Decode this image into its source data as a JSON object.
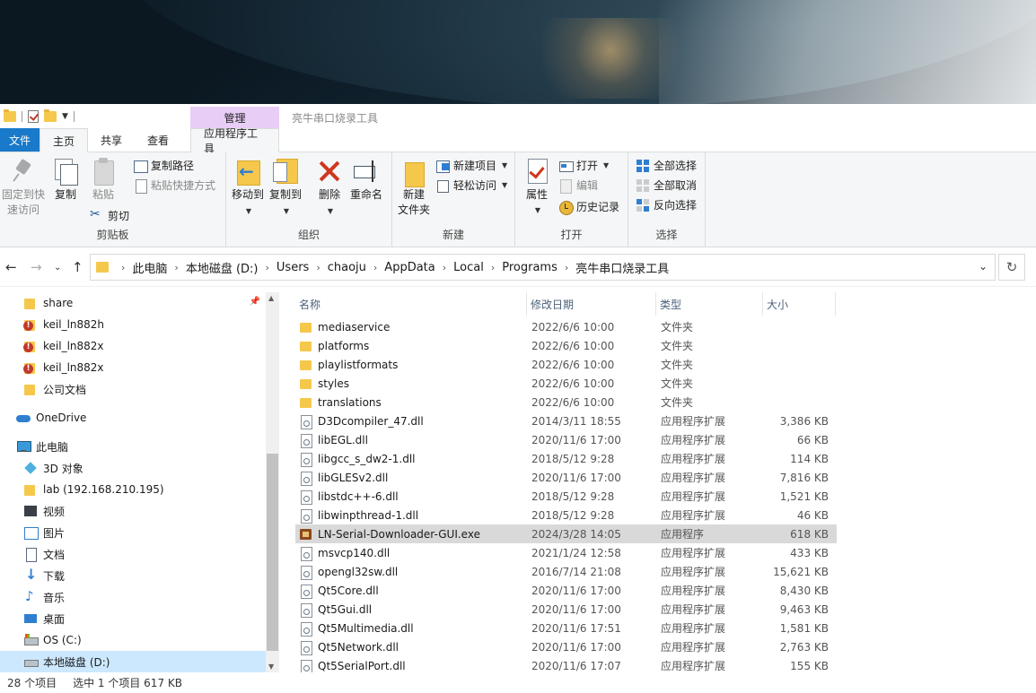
{
  "window_title": "亮牛串口烧录工具",
  "context_group": "管理",
  "tabs": [
    {
      "label": "文件"
    },
    {
      "label": "主页"
    },
    {
      "label": "共享"
    },
    {
      "label": "查看"
    },
    {
      "label": "应用程序工具"
    }
  ],
  "ribbon": {
    "clipboard": {
      "label": "剪贴板",
      "pin": "固定到快\n速访问",
      "pin_line1": "固定到快",
      "pin_line2": "速访问",
      "copy": "复制",
      "paste": "粘贴",
      "copy_path": "复制路径",
      "paste_shortcut": "粘贴快捷方式",
      "cut": "剪切"
    },
    "organize": {
      "label": "组织",
      "move_to": "移动到",
      "copy_to": "复制到",
      "delete": "删除",
      "rename": "重命名"
    },
    "new": {
      "label": "新建",
      "new_folder_line1": "新建",
      "new_folder_line2": "文件夹",
      "new_item": "新建项目",
      "easy_access": "轻松访问"
    },
    "open": {
      "label": "打开",
      "properties": "属性",
      "open": "打开",
      "edit": "编辑",
      "history": "历史记录"
    },
    "select": {
      "label": "选择",
      "select_all": "全部选择",
      "select_none": "全部取消",
      "invert": "反向选择"
    }
  },
  "address": {
    "crumbs": [
      "此电脑",
      "本地磁盘 (D:)",
      "Users",
      "chaoju",
      "AppData",
      "Local",
      "Programs",
      "亮牛串口烧录工具"
    ]
  },
  "nav": {
    "items": [
      {
        "label": "share",
        "icon": "folder-icon"
      },
      {
        "label": "keil_ln882h",
        "icon": "folder-error-icon"
      },
      {
        "label": "keil_ln882x",
        "icon": "folder-error-icon"
      },
      {
        "label": "keil_ln882x",
        "icon": "folder-error-icon"
      },
      {
        "label": "公司文档",
        "icon": "folder-icon"
      },
      {
        "label": "OneDrive",
        "icon": "onedrive-icon"
      },
      {
        "label": "此电脑",
        "icon": "pc-icon"
      },
      {
        "label": "3D 对象",
        "icon": "3d-objects-icon"
      },
      {
        "label": "lab (192.168.210.195)",
        "icon": "network-folder-icon"
      },
      {
        "label": "视频",
        "icon": "video-icon"
      },
      {
        "label": "图片",
        "icon": "pictures-icon"
      },
      {
        "label": "文档",
        "icon": "documents-icon"
      },
      {
        "label": "下载",
        "icon": "downloads-icon"
      },
      {
        "label": "音乐",
        "icon": "music-icon"
      },
      {
        "label": "桌面",
        "icon": "desktop-icon"
      },
      {
        "label": "OS (C:)",
        "icon": "drive-c-icon"
      },
      {
        "label": "本地磁盘 (D:)",
        "icon": "drive-d-icon"
      }
    ]
  },
  "columns": {
    "name": "名称",
    "modified": "修改日期",
    "type": "类型",
    "size": "大小"
  },
  "files": [
    {
      "name": "mediaservice",
      "date": "2022/6/6 10:00",
      "type": "文件夹",
      "size": "",
      "icon": "folder-icon"
    },
    {
      "name": "platforms",
      "date": "2022/6/6 10:00",
      "type": "文件夹",
      "size": "",
      "icon": "folder-icon"
    },
    {
      "name": "playlistformats",
      "date": "2022/6/6 10:00",
      "type": "文件夹",
      "size": "",
      "icon": "folder-icon"
    },
    {
      "name": "styles",
      "date": "2022/6/6 10:00",
      "type": "文件夹",
      "size": "",
      "icon": "folder-icon"
    },
    {
      "name": "translations",
      "date": "2022/6/6 10:00",
      "type": "文件夹",
      "size": "",
      "icon": "folder-icon"
    },
    {
      "name": "D3Dcompiler_47.dll",
      "date": "2014/3/11 18:55",
      "type": "应用程序扩展",
      "size": "3,386 KB",
      "icon": "dll-icon"
    },
    {
      "name": "libEGL.dll",
      "date": "2020/11/6 17:00",
      "type": "应用程序扩展",
      "size": "66 KB",
      "icon": "dll-icon"
    },
    {
      "name": "libgcc_s_dw2-1.dll",
      "date": "2018/5/12 9:28",
      "type": "应用程序扩展",
      "size": "114 KB",
      "icon": "dll-icon"
    },
    {
      "name": "libGLESv2.dll",
      "date": "2020/11/6 17:00",
      "type": "应用程序扩展",
      "size": "7,816 KB",
      "icon": "dll-icon"
    },
    {
      "name": "libstdc++-6.dll",
      "date": "2018/5/12 9:28",
      "type": "应用程序扩展",
      "size": "1,521 KB",
      "icon": "dll-icon"
    },
    {
      "name": "libwinpthread-1.dll",
      "date": "2018/5/12 9:28",
      "type": "应用程序扩展",
      "size": "46 KB",
      "icon": "dll-icon"
    },
    {
      "name": "LN-Serial-Downloader-GUI.exe",
      "date": "2024/3/28 14:05",
      "type": "应用程序",
      "size": "618 KB",
      "icon": "exe-icon",
      "selected": true
    },
    {
      "name": "msvcp140.dll",
      "date": "2021/1/24 12:58",
      "type": "应用程序扩展",
      "size": "433 KB",
      "icon": "dll-icon"
    },
    {
      "name": "opengl32sw.dll",
      "date": "2016/7/14 21:08",
      "type": "应用程序扩展",
      "size": "15,621 KB",
      "icon": "dll-icon"
    },
    {
      "name": "Qt5Core.dll",
      "date": "2020/11/6 17:00",
      "type": "应用程序扩展",
      "size": "8,430 KB",
      "icon": "dll-icon"
    },
    {
      "name": "Qt5Gui.dll",
      "date": "2020/11/6 17:00",
      "type": "应用程序扩展",
      "size": "9,463 KB",
      "icon": "dll-icon"
    },
    {
      "name": "Qt5Multimedia.dll",
      "date": "2020/11/6 17:51",
      "type": "应用程序扩展",
      "size": "1,581 KB",
      "icon": "dll-icon"
    },
    {
      "name": "Qt5Network.dll",
      "date": "2020/11/6 17:00",
      "type": "应用程序扩展",
      "size": "2,763 KB",
      "icon": "dll-icon"
    },
    {
      "name": "Qt5SerialPort.dll",
      "date": "2020/11/6 17:07",
      "type": "应用程序扩展",
      "size": "155 KB",
      "icon": "dll-icon"
    }
  ],
  "status": {
    "count": "28 个项目",
    "selection": "选中 1 个项目  617 KB"
  },
  "colors": {
    "file_tab": "#1979ca",
    "context_tab": "#e8cdf6",
    "nav_selected": "#cce8ff",
    "row_selected": "#d9d9d9"
  }
}
